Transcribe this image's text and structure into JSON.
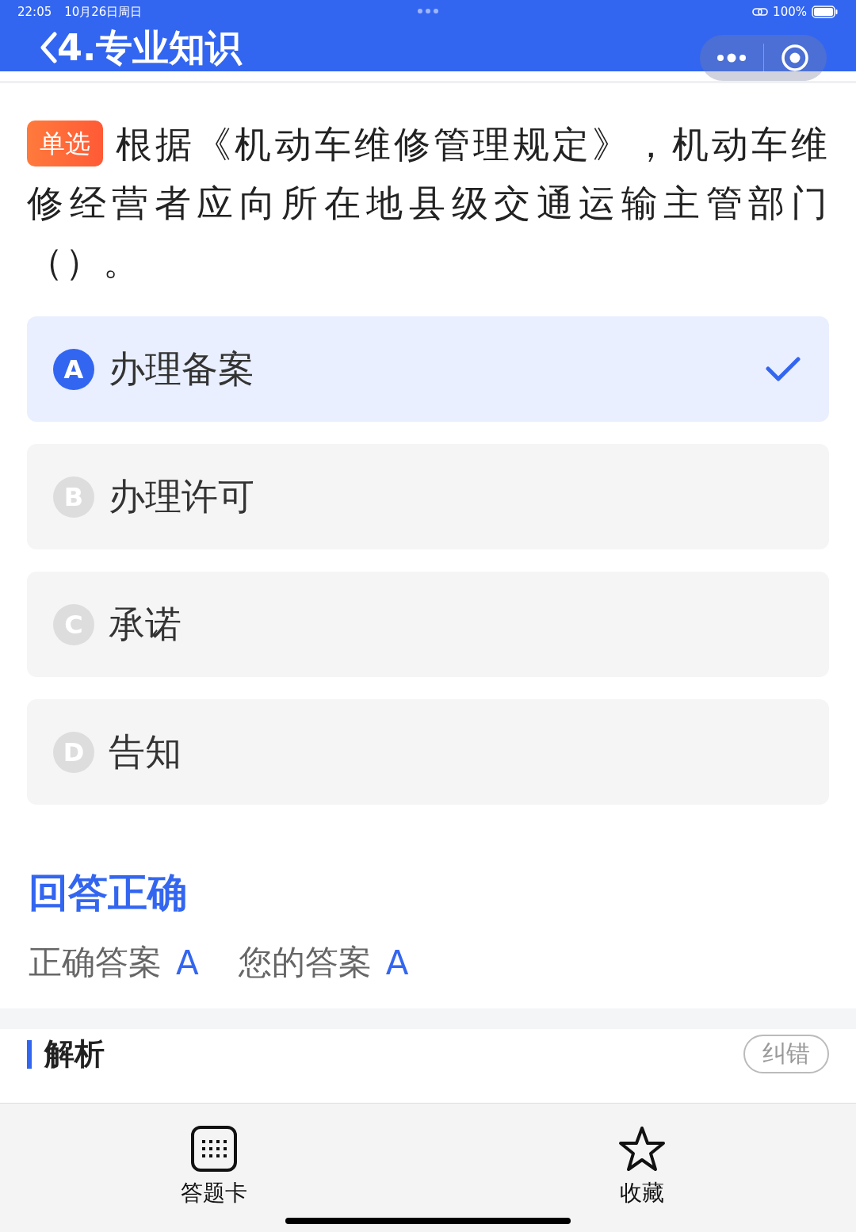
{
  "status_bar": {
    "time": "22:05",
    "date": "10月26日周日",
    "battery": "100%"
  },
  "header": {
    "title": "4.专业知识"
  },
  "question": {
    "tag": "单选",
    "text": "根据《机动车维修管理规定》，机动车维修经营者应向所在地县级交通运输主管部门（）。"
  },
  "options": [
    {
      "letter": "A",
      "text": "办理备案",
      "selected": true
    },
    {
      "letter": "B",
      "text": "办理许可",
      "selected": false
    },
    {
      "letter": "C",
      "text": "承诺",
      "selected": false
    },
    {
      "letter": "D",
      "text": "告知",
      "selected": false
    }
  ],
  "result": {
    "title": "回答正确",
    "correct_label": "正确答案",
    "correct_value": "A",
    "your_label": "您的答案",
    "your_value": "A"
  },
  "analysis": {
    "title": "解析",
    "report_button": "纠错"
  },
  "bottom_bar": [
    {
      "label": "答题卡",
      "kind": "grid"
    },
    {
      "label": "收藏",
      "kind": "star"
    }
  ]
}
